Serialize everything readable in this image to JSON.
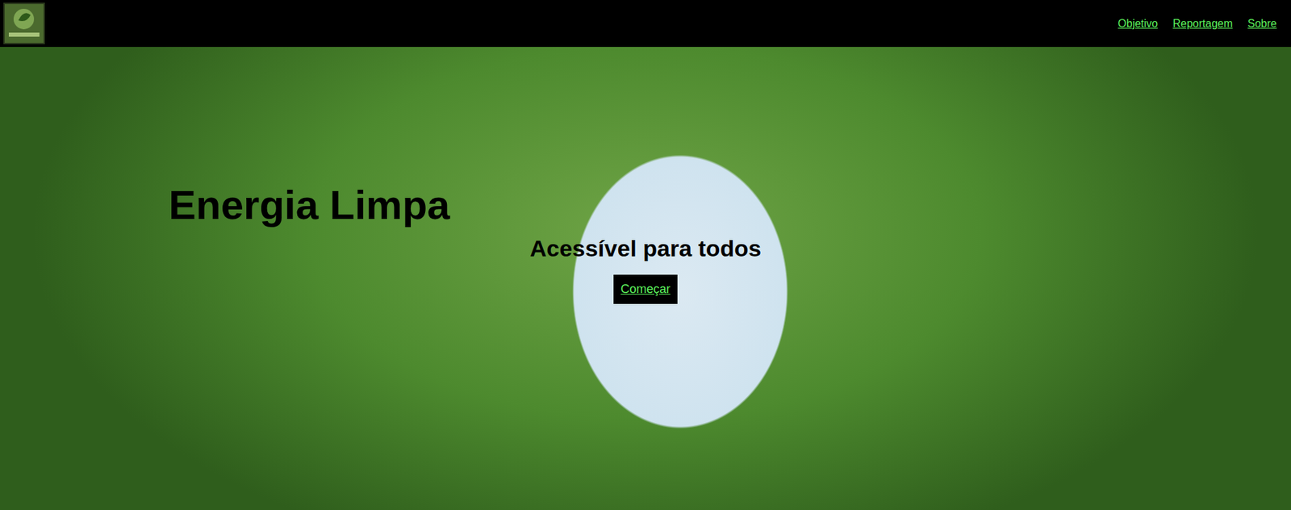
{
  "nav": {
    "links": [
      "Objetivo",
      "Reportagem",
      "Sobre"
    ]
  },
  "hero": {
    "title": "Energia Limpa",
    "subtitle": "Acessível para todos",
    "button": "Começar"
  }
}
